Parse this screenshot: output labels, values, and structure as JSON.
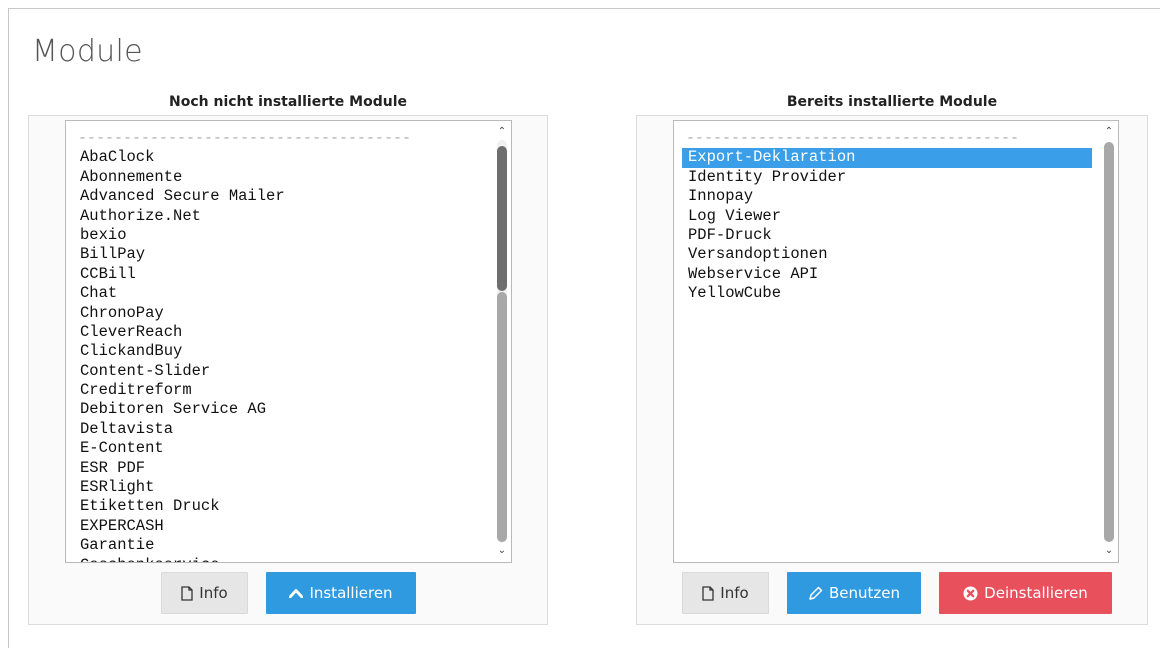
{
  "page": {
    "title": "Module"
  },
  "left": {
    "heading": "Noch nicht installierte Module",
    "separator": "-------------------------------------",
    "items": [
      "AbaClock",
      "Abonnemente",
      "Advanced Secure Mailer",
      "Authorize.Net",
      "bexio",
      "BillPay",
      "CCBill",
      "Chat",
      "ChronoPay",
      "CleverReach",
      "ClickandBuy",
      "Content-Slider",
      "Creditreform",
      "Debitoren Service AG",
      "Deltavista",
      "E-Content",
      "ESR PDF",
      "ESRlight",
      "Etiketten Druck",
      "EXPERCASH",
      "Garantie",
      "Geschenkservice"
    ],
    "buttons": {
      "info": "Info",
      "install": "Installieren"
    }
  },
  "right": {
    "heading": "Bereits installierte Module",
    "separator": "-------------------------------------",
    "items": [
      "Export-Deklaration",
      "Identity Provider",
      "Innopay",
      "Log Viewer",
      "PDF-Druck",
      "Versandoptionen",
      "Webservice API",
      "YellowCube"
    ],
    "selected_index": 0,
    "buttons": {
      "info": "Info",
      "use": "Benutzen",
      "uninstall": "Deinstallieren"
    }
  },
  "icons": {
    "info": "file-icon",
    "install": "chevron-up-icon",
    "use": "pencil-icon",
    "uninstall": "times-circle-icon"
  },
  "colors": {
    "primary": "#2f9ae0",
    "danger": "#e8505b",
    "default_button": "#e6e6e6",
    "selection": "#3a9ee8"
  }
}
